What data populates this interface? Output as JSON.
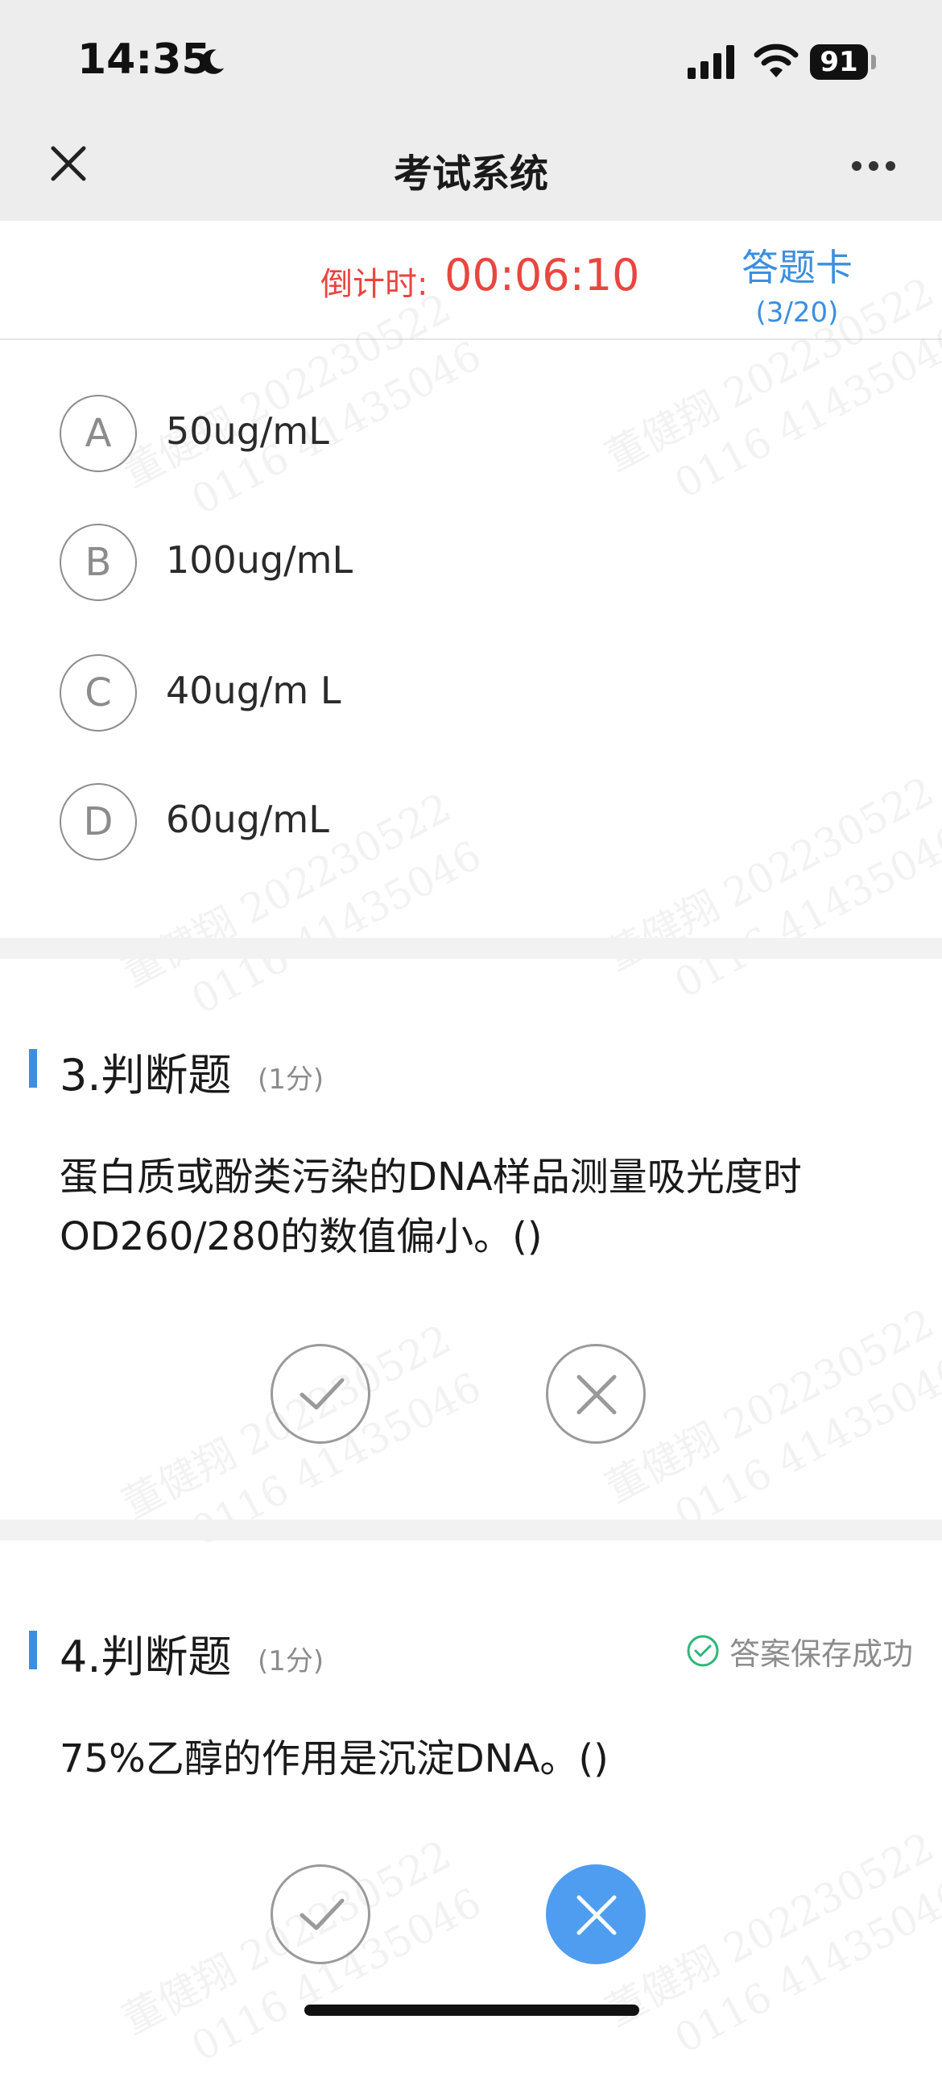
{
  "status": {
    "time": "14:35",
    "battery": "91"
  },
  "nav": {
    "title": "考试系统"
  },
  "timer": {
    "label": "倒计时:",
    "value": "00:06:10"
  },
  "answer_card": {
    "label": "答题卡",
    "progress": "(3/20)"
  },
  "q2_options": [
    {
      "letter": "A",
      "text": "50ug/mL"
    },
    {
      "letter": "B",
      "text": "100ug/mL"
    },
    {
      "letter": "C",
      "text": "40ug/m L"
    },
    {
      "letter": "D",
      "text": "60ug/mL"
    }
  ],
  "q3": {
    "title": "3.判断题",
    "score": "(1分)",
    "text": "蛋白质或酚类污染的DNA样品测量吸光度时OD260/280的数值偏小。()",
    "selected": "none"
  },
  "q4": {
    "title": "4.判断题",
    "score": "(1分)",
    "text": "75%乙醇的作用是沉淀DNA。()",
    "saved_message": "答案保存成功",
    "selected": "false"
  },
  "watermark": {
    "name_line": "董健翔 202230522",
    "id_line": "0116 41435046"
  },
  "colors": {
    "accent": "#3b8fe0",
    "timer": "#e8463f",
    "selected": "#4f9df0",
    "saved_ok": "#2db77a"
  }
}
